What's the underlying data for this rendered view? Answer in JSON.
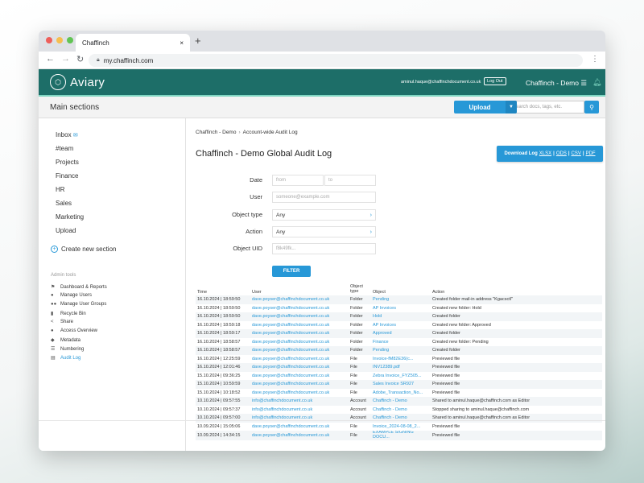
{
  "browser": {
    "tab_title": "Chaffinch",
    "tab_close": "×",
    "new_tab": "+",
    "url": "my.chaffinch.com",
    "dots": [
      "#ee5f5b",
      "#f6be4f",
      "#61c454"
    ]
  },
  "header": {
    "logo": "Aviary",
    "user_email": "aminul.haque@chaffinchdocument.co.uk",
    "logout": "Log Out",
    "org": "Chaffinch - Demo ☰"
  },
  "sections_bar": {
    "title": "Main sections",
    "upload": "Upload",
    "search_placeholder": "Search docs, tags, etc."
  },
  "sidebar": {
    "items": [
      "Inbox",
      "#team",
      "Projects",
      "Finance",
      "HR",
      "Sales",
      "Marketing",
      "Upload"
    ],
    "create": "Create new section",
    "admin_title": "Admin tools",
    "admin_items": [
      "Dashboard & Reports",
      "Manage Users",
      "Manage User Groups",
      "Recycle Bin",
      "Share",
      "Access Overview",
      "Metadata",
      "Numbering",
      "Audit Log"
    ]
  },
  "breadcrumb": [
    "Chaffinch - Demo",
    "Account-wide Audit Log"
  ],
  "page_title": "Chaffinch - Demo Global Audit Log",
  "download": {
    "label": "Download Log",
    "xlsx": "XLSX",
    "ods": "ODS",
    "csv": "CSV",
    "pdf": "PDF",
    "sep": "|"
  },
  "filters": {
    "date_label": "Date",
    "from_placeholder": "from",
    "to_placeholder": "to",
    "user_label": "User",
    "user_placeholder": "someone@example.com",
    "object_type_label": "Object type",
    "object_type_value": "Any",
    "action_label": "Action",
    "action_value": "Any",
    "object_uid_label": "Object UID",
    "object_uid_placeholder": "f8k49fk...",
    "filter_button": "FILTER"
  },
  "table": {
    "headers": [
      "Time",
      "User",
      "Object type",
      "Object",
      "Action"
    ],
    "rows": [
      [
        "16.10.2024 | 18:59:50",
        "dave.poyser@chaffinchdocument.co.uk",
        "Folder",
        "Pending",
        "Created folder mail-in address \"Kgacsctl\""
      ],
      [
        "16.10.2024 | 18:59:50",
        "dave.poyser@chaffinchdocument.co.uk",
        "Folder",
        "AP Invoices",
        "Created new folder: Hold"
      ],
      [
        "16.10.2024 | 18:59:50",
        "dave.poyser@chaffinchdocument.co.uk",
        "Folder",
        "Hold",
        "Created folder"
      ],
      [
        "16.10.2024 | 18:59:18",
        "dave.poyser@chaffinchdocument.co.uk",
        "Folder",
        "AP Invoices",
        "Created new folder: Approved"
      ],
      [
        "16.10.2024 | 18:59:17",
        "dave.poyser@chaffinchdocument.co.uk",
        "Folder",
        "Approved",
        "Created folder"
      ],
      [
        "16.10.2024 | 18:58:57",
        "dave.poyser@chaffinchdocument.co.uk",
        "Folder",
        "Finance",
        "Created new folder: Pending"
      ],
      [
        "16.10.2024 | 18:58:57",
        "dave.poyser@chaffinchdocument.co.uk",
        "Folder",
        "Pending",
        "Created folder"
      ],
      [
        "16.10.2024 | 12:25:59",
        "dave.poyser@chaffinchdocument.co.uk",
        "File",
        "Invoice-fM82E36(c...",
        "Previewed file"
      ],
      [
        "16.10.2024 | 12:01:46",
        "dave.poyser@chaffinchdocument.co.uk",
        "File",
        "INV12389.pdf",
        "Previewed file"
      ],
      [
        "15.10.2024 | 09:36:25",
        "dave.poyser@chaffinchdocument.co.uk",
        "File",
        "Zebra Invoice_FYZ505...",
        "Previewed file"
      ],
      [
        "15.10.2024 | 10:59:59",
        "dave.poyser@chaffinchdocument.co.uk",
        "File",
        "Sales Invoice SR927",
        "Previewed file"
      ],
      [
        "15.10.2024 | 10:18:52",
        "dave.poyser@chaffinchdocument.co.uk",
        "File",
        "Adobe_Transaction_No...",
        "Previewed file"
      ],
      [
        "10.10.2024 | 09:57:55",
        "info@chaffinchdocument.co.uk",
        "Account",
        "Chaffinch - Demo",
        "Shared to aminul.haque@chaffinch.com as Editor"
      ],
      [
        "10.10.2024 | 09:57:37",
        "info@chaffinchdocument.co.uk",
        "Account",
        "Chaffinch - Demo",
        "Stopped sharing to aminul.haque@chaffinch.com"
      ],
      [
        "10.10.2024 | 09:57:00",
        "info@chaffinchdocument.co.uk",
        "Account",
        "Chaffinch - Demo",
        "Shared to aminul.haque@chaffinch.com as Editor"
      ],
      [
        "10.09.2024 | 15:05:06",
        "dave.poyser@chaffinchdocument.co.uk",
        "File",
        "Invoice_2024-08-08_2...",
        "Previewed file"
      ],
      [
        "10.09.2024 | 14:34:15",
        "dave.poyser@chaffinchdocument.co.uk",
        "File",
        "EXAMPLE SIGNING DOCU...",
        "Previewed file"
      ]
    ]
  },
  "colors": {
    "brand": "#1d6e68",
    "accent": "#2798d7",
    "mint": "#7fd6c2"
  },
  "icons": {
    "back": "back-arrow-icon",
    "forward": "forward-arrow-icon",
    "reload": "reload-icon",
    "lock": "lock-icon",
    "menu": "kebab-menu-icon",
    "bell": "bell-icon",
    "search": "search-icon"
  }
}
